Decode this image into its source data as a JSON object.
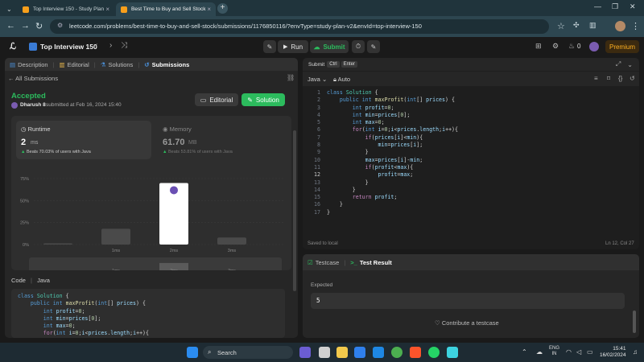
{
  "browser": {
    "tabs": [
      {
        "title": "Top Interview 150 - Study Plan",
        "active": false
      },
      {
        "title": "Best Time to Buy and Sell Stock",
        "active": true
      }
    ],
    "url": "leetcode.com/problems/best-time-to-buy-and-sell-stock/submissions/1176850116/?envType=study-plan-v2&envId=top-interview-150"
  },
  "header": {
    "list_title": "Top Interview 150",
    "run_label": "Run",
    "submit_label": "Submit",
    "coins": "0",
    "premium_label": "Premium"
  },
  "left": {
    "tabs": [
      "Description",
      "Editorial",
      "Solutions",
      "Submissions"
    ],
    "back_label": "All Submissions",
    "status": "Accepted",
    "author": "Dharush 8",
    "submitted_text": "submitted at Feb 16, 2024 15:40",
    "editorial_btn": "Editorial",
    "solution_btn": "Solution",
    "runtime_label": "Runtime",
    "runtime_value": "2",
    "runtime_unit": "ms",
    "runtime_beats": "Beats 70.03% of users with Java",
    "memory_label": "Memory",
    "memory_value": "61.70",
    "memory_unit": "MB",
    "memory_beats": "Beats 53.81% of users with Java",
    "code_label": "Code",
    "code_lang": "Java"
  },
  "chart_data": {
    "type": "bar",
    "categories": [
      "0ms",
      "1ms",
      "2ms",
      "3ms"
    ],
    "tick_labels": [
      "",
      "1ms",
      "2ms",
      "3ms"
    ],
    "values": [
      1,
      18,
      70,
      8
    ],
    "highlight": "2ms",
    "ylim": [
      0,
      75
    ],
    "yticks": [
      "75%",
      "50%",
      "25%",
      "0%"
    ],
    "grid": true
  },
  "editor": {
    "tabs": [
      "Submit",
      "Ctrl",
      "Enter"
    ],
    "lang": "Java",
    "mode": "Auto",
    "saved_text": "Saved to local",
    "cursor_pos": "Ln 12, Col 27",
    "line_numbers": [
      "1",
      "2",
      "3",
      "4",
      "5",
      "6",
      "7",
      "8",
      "9",
      "10",
      "11",
      "12",
      "13",
      "14",
      "15",
      "16",
      "17"
    ]
  },
  "console": {
    "tab_testcase": "Testcase",
    "tab_result": "Test Result",
    "expected_label": "Expected",
    "expected_value": "5",
    "contribute_label": "Contribute a testcase"
  },
  "taskbar": {
    "search_placeholder": "Search",
    "lang1": "ENG",
    "lang2": "IN",
    "time": "15:41",
    "date": "16/02/2024"
  }
}
